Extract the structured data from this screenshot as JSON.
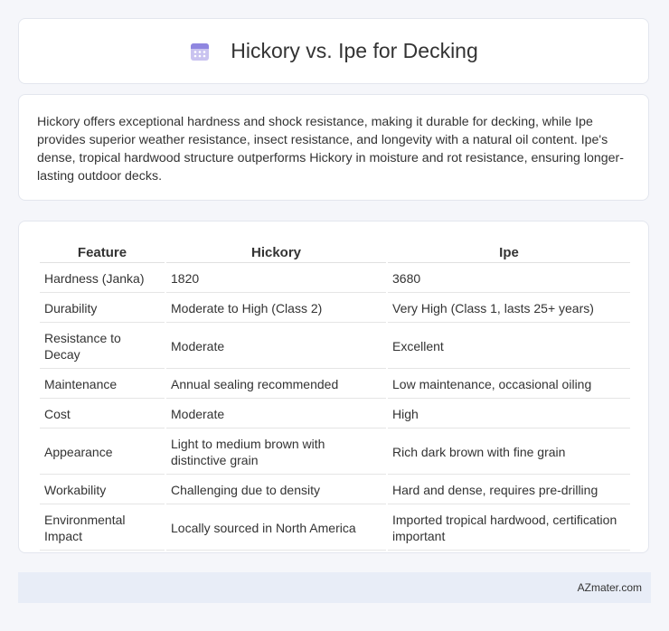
{
  "header": {
    "title": "Hickory vs. Ipe for Decking",
    "icon": "calendar-icon"
  },
  "summary": {
    "text": "Hickory offers exceptional hardness and shock resistance, making it durable for decking, while Ipe provides superior weather resistance, insect resistance, and longevity with a natural oil content. Ipe's dense, tropical hardwood structure outperforms Hickory in moisture and rot resistance, ensuring longer-lasting outdoor decks."
  },
  "table": {
    "headers": [
      "Feature",
      "Hickory",
      "Ipe"
    ],
    "rows": [
      [
        "Hardness (Janka)",
        "1820",
        "3680"
      ],
      [
        "Durability",
        "Moderate to High (Class 2)",
        "Very High (Class 1, lasts 25+ years)"
      ],
      [
        "Resistance to Decay",
        "Moderate",
        "Excellent"
      ],
      [
        "Maintenance",
        "Annual sealing recommended",
        "Low maintenance, occasional oiling"
      ],
      [
        "Cost",
        "Moderate",
        "High"
      ],
      [
        "Appearance",
        "Light to medium brown with distinctive grain",
        "Rich dark brown with fine grain"
      ],
      [
        "Workability",
        "Challenging due to density",
        "Hard and dense, requires pre-drilling"
      ],
      [
        "Environmental Impact",
        "Locally sourced in North America",
        "Imported tropical hardwood, certification important"
      ]
    ]
  },
  "footer": {
    "text": "AZmater.com"
  }
}
